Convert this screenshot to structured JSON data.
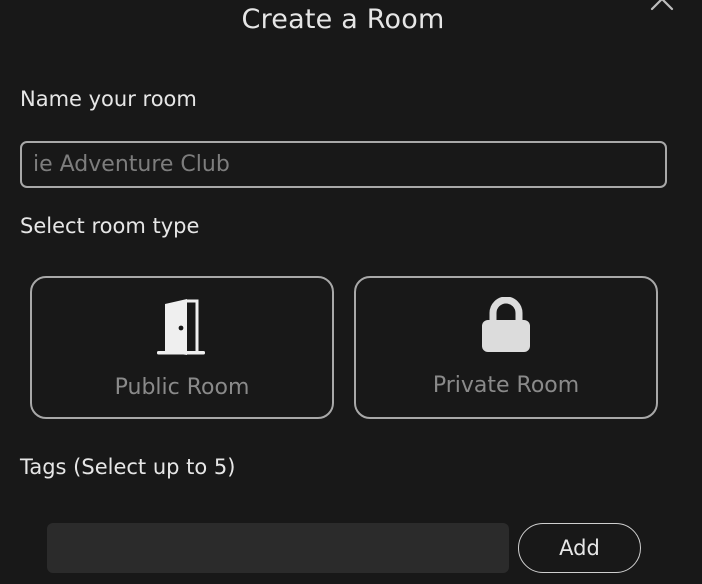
{
  "dialog": {
    "title": "Create a Room",
    "close_icon": "close-icon"
  },
  "name_section": {
    "label": "Name your room",
    "input_value": "",
    "input_placeholder": "ie Adventure Club"
  },
  "room_type_section": {
    "label": "Select room type",
    "options": [
      {
        "label": "Public Room",
        "icon": "door-icon"
      },
      {
        "label": "Private Room",
        "icon": "lock-icon"
      }
    ]
  },
  "tags_section": {
    "label": "Tags (Select up to 5)",
    "input_value": "",
    "add_label": "Add"
  },
  "colors": {
    "background": "#181818",
    "text": "#e6e6e6",
    "muted_text": "#8a8a8a",
    "border": "#a8a8a8",
    "input_fill": "#2b2b2b"
  }
}
